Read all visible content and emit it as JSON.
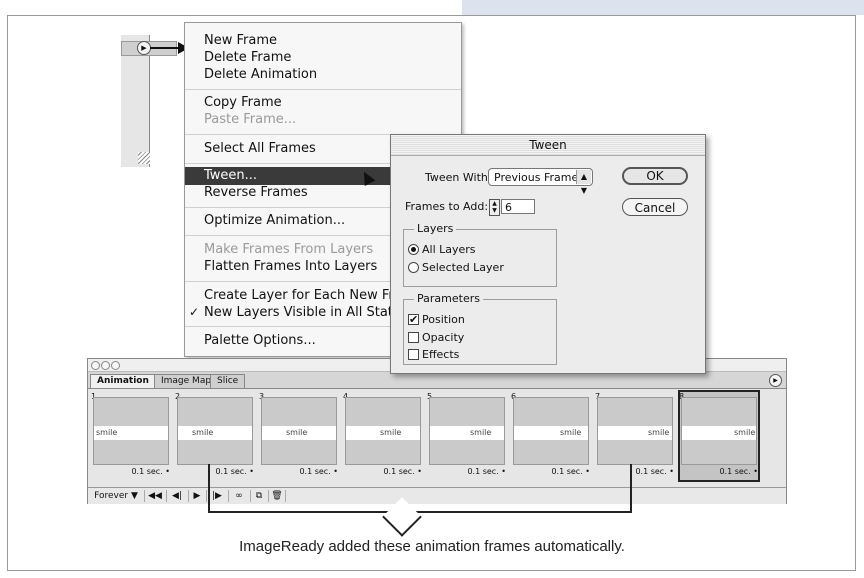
{
  "menu": {
    "items": [
      {
        "label": "New Frame",
        "disabled": false
      },
      {
        "label": "Delete Frame",
        "disabled": false
      },
      {
        "label": "Delete Animation",
        "disabled": false
      },
      {
        "label": "Copy Frame",
        "disabled": false
      },
      {
        "label": "Paste Frame...",
        "disabled": true
      },
      {
        "label": "Select All Frames",
        "disabled": false
      },
      {
        "label": "Tween...",
        "disabled": false
      },
      {
        "label": "Reverse Frames",
        "disabled": false
      },
      {
        "label": "Optimize Animation...",
        "disabled": false
      },
      {
        "label": "Make Frames From Layers",
        "disabled": true
      },
      {
        "label": "Flatten Frames Into Layers",
        "disabled": false
      },
      {
        "label": "Create Layer for Each New Fra",
        "disabled": false
      },
      {
        "label": "New Layers Visible in All States",
        "disabled": false
      },
      {
        "label": "Palette Options...",
        "disabled": false
      }
    ],
    "check_mark": "✓"
  },
  "dialog": {
    "title": "Tween",
    "tween_with_label": "Tween With:",
    "tween_with_value": "Previous Frame",
    "frames_to_add_label": "Frames to Add:",
    "frames_to_add_value": "6",
    "ok_label": "OK",
    "cancel_label": "Cancel",
    "layers_group": "Layers",
    "all_layers": "All Layers",
    "selected_layer": "Selected Layer",
    "parameters_group": "Parameters",
    "position": "Position",
    "opacity": "Opacity",
    "effects": "Effects",
    "checked_mark": "✔"
  },
  "palette": {
    "tabs": [
      "Animation",
      "Image Map",
      "Slice"
    ],
    "frames": [
      {
        "num": "1",
        "text": "smile",
        "delay": "0.1 sec. •"
      },
      {
        "num": "2",
        "text": "smile",
        "delay": "0.1 sec. •"
      },
      {
        "num": "3",
        "text": "smile",
        "delay": "0.1 sec. •"
      },
      {
        "num": "4",
        "text": "smile",
        "delay": "0.1 sec. •"
      },
      {
        "num": "5",
        "text": "smile",
        "delay": "0.1 sec. •"
      },
      {
        "num": "6",
        "text": "smile",
        "delay": "0.1 sec. •"
      },
      {
        "num": "7",
        "text": "smile",
        "delay": "0.1 sec. •"
      },
      {
        "num": "8",
        "text": "smile",
        "delay": "0.1 sec. •"
      }
    ],
    "loop_label": "Forever ▼",
    "controls": [
      "◀◀",
      "◀|",
      "▶",
      "|▶",
      "∞",
      "⧉",
      "🗑"
    ]
  },
  "caption": "ImageReady added these animation frames automatically."
}
